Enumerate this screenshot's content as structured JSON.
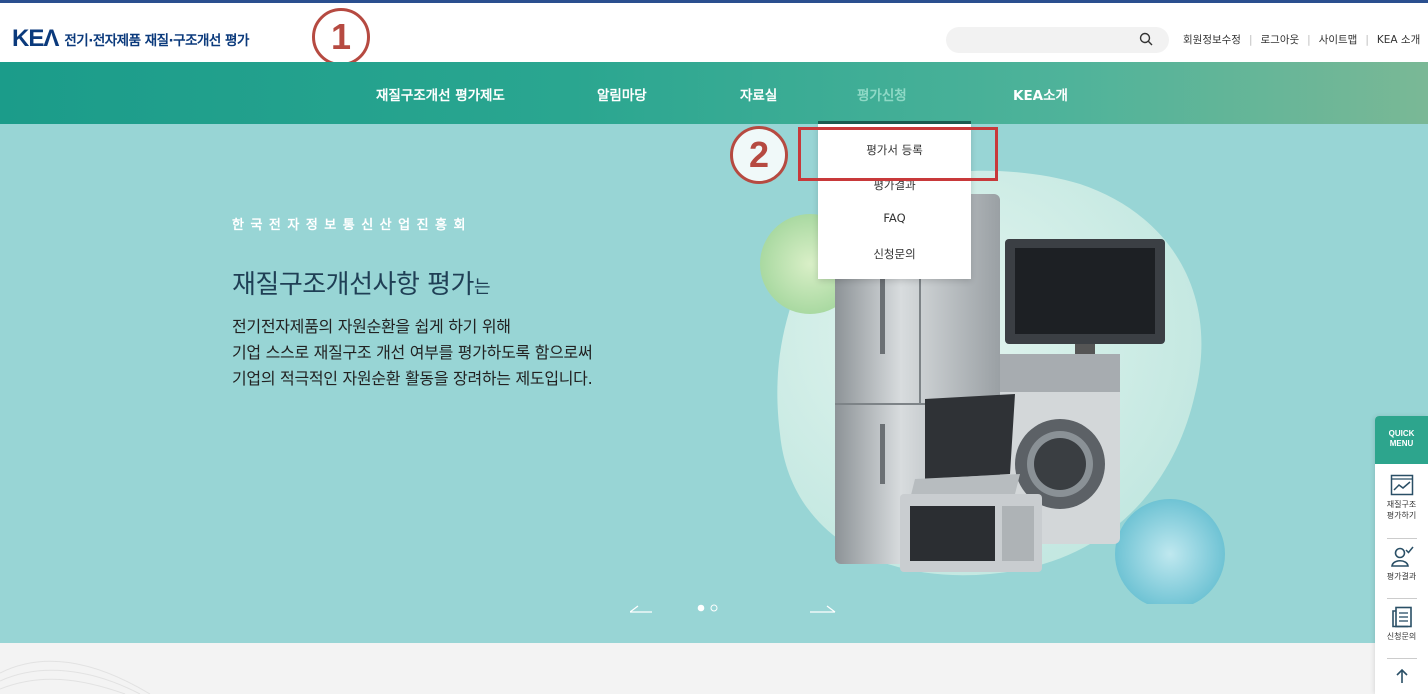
{
  "header": {
    "logo_mark": "KEΛ",
    "logo_text": "전기·전자제품 재질·구조개선 평가",
    "util_links": [
      "회원정보수정",
      "로그아웃",
      "사이트맵",
      "KEA 소개"
    ]
  },
  "annotations": {
    "badge1": "1",
    "badge2": "2"
  },
  "nav": {
    "items": [
      "재질구조개선 평가제도",
      "알림마당",
      "자료실",
      "평가신청",
      "KEA소개"
    ],
    "active": "평가신청"
  },
  "dropdown": {
    "items": [
      "평가서 등록",
      "평가결과",
      "FAQ",
      "신청문의"
    ]
  },
  "hero": {
    "subtitle": "한국전자정보통신산업진흥회",
    "title_main": "재질구조개선사항 평가",
    "title_suffix": "는",
    "desc": [
      "전기전자제품의 자원순환을 쉽게 하기 위해",
      "기업 스스로 재질구조 개선 여부를 평가하도록 함으로써",
      "기업의 적극적인 자원순환 활동을 장려하는 제도입니다."
    ],
    "slide_count": 2,
    "active_slide": 1
  },
  "quick_menu": {
    "title_line1": "QUICK",
    "title_line2": "MENU",
    "items": [
      {
        "label_line1": "재질구조",
        "label_line2": "평가하기",
        "icon": "chart-icon"
      },
      {
        "label_line1": "평가결과",
        "label_line2": "",
        "icon": "user-check-icon"
      },
      {
        "label_line1": "신청문의",
        "label_line2": "",
        "icon": "document-icon"
      }
    ],
    "top_icon": "arrow-up-icon"
  },
  "colors": {
    "brand_blue": "#0b3a7c",
    "nav_teal": "#2aa690",
    "hero_bg": "#98d5d5",
    "annotation_red": "#c8393a"
  }
}
